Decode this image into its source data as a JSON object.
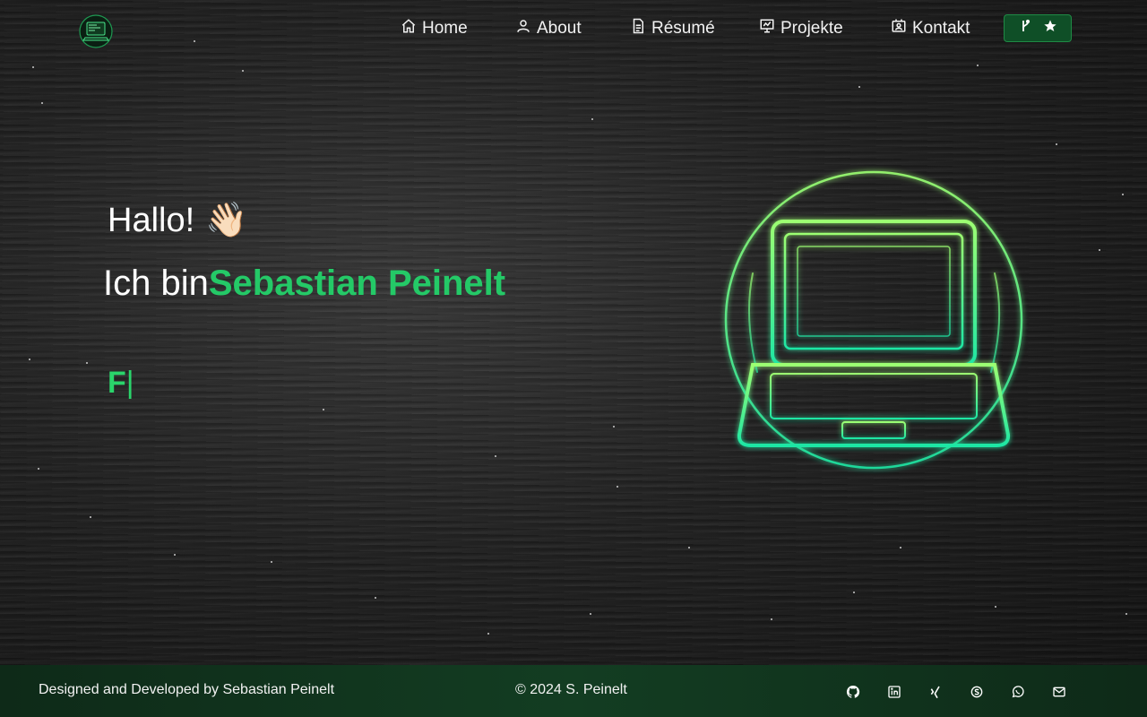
{
  "nav": {
    "logo_icon": "laptop-logo-icon",
    "items": [
      {
        "label": "Home",
        "icon": "home-icon"
      },
      {
        "label": "About",
        "icon": "user-icon"
      },
      {
        "label": "Résumé",
        "icon": "document-icon"
      },
      {
        "label": "Projekte",
        "icon": "presentation-icon"
      },
      {
        "label": "Kontakt",
        "icon": "contact-card-icon"
      }
    ],
    "github_button": {
      "icons": [
        "fork-icon",
        "star-icon"
      ],
      "color": "#0f4f27"
    }
  },
  "hero": {
    "greeting": "Hallo!",
    "wave_emoji": "👋🏻",
    "intro": "Ich bin",
    "name": "Sebastian Peinelt",
    "typed_text": "F",
    "cursor": "|",
    "accent_color": "#24c967",
    "illustration": "neon-laptop-illustration"
  },
  "footer": {
    "credit": "Designed and Developed by Sebastian Peinelt",
    "copyright": "© 2024 S. Peinelt",
    "social_icons": [
      "github-icon",
      "linkedin-icon",
      "xing-icon",
      "skype-icon",
      "whatsapp-icon",
      "mail-icon"
    ]
  }
}
